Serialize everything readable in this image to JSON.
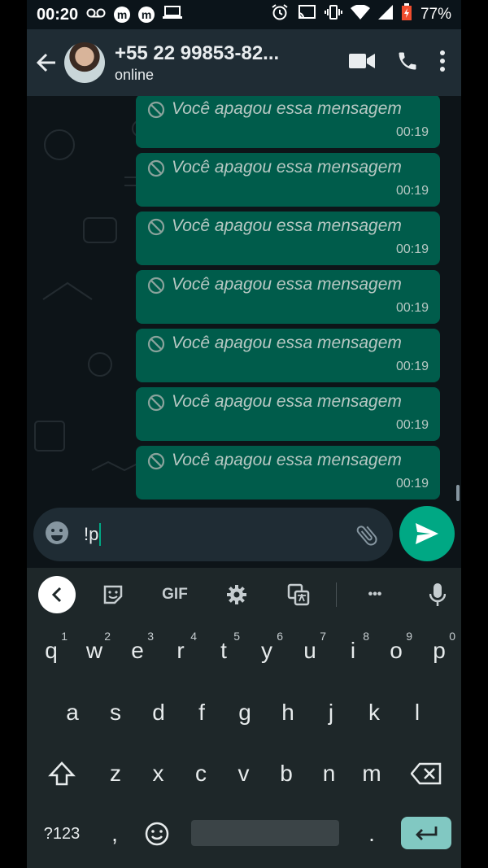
{
  "status_bar": {
    "time": "00:20",
    "battery": "77%",
    "m_glyph": "m"
  },
  "header": {
    "title": "+55 22 99853-82...",
    "subtitle": "online"
  },
  "messages": [
    {
      "text": "Você apagou essa mensagem",
      "time": "00:19"
    },
    {
      "text": "Você apagou essa mensagem",
      "time": "00:19"
    },
    {
      "text": "Você apagou essa mensagem",
      "time": "00:19"
    },
    {
      "text": "Você apagou essa mensagem",
      "time": "00:19"
    },
    {
      "text": "Você apagou essa mensagem",
      "time": "00:19"
    },
    {
      "text": "Você apagou essa mensagem",
      "time": "00:19"
    },
    {
      "text": "Você apagou essa mensagem",
      "time": "00:19"
    }
  ],
  "input": {
    "value": "!p"
  },
  "keyboard": {
    "toolbar": {
      "gif": "GIF",
      "more": "•••"
    },
    "row1": [
      {
        "k": "q",
        "h": "1"
      },
      {
        "k": "w",
        "h": "2"
      },
      {
        "k": "e",
        "h": "3"
      },
      {
        "k": "r",
        "h": "4"
      },
      {
        "k": "t",
        "h": "5"
      },
      {
        "k": "y",
        "h": "6"
      },
      {
        "k": "u",
        "h": "7"
      },
      {
        "k": "i",
        "h": "8"
      },
      {
        "k": "o",
        "h": "9"
      },
      {
        "k": "p",
        "h": "0"
      }
    ],
    "row2": [
      "a",
      "s",
      "d",
      "f",
      "g",
      "h",
      "j",
      "k",
      "l"
    ],
    "row3": [
      "z",
      "x",
      "c",
      "v",
      "b",
      "n",
      "m"
    ],
    "row4": {
      "symbols": "?123",
      "comma": ",",
      "period": "."
    }
  },
  "colors": {
    "accent": "#00a884",
    "bubble": "#005c4b",
    "header": "#1f2c34",
    "keyboard": "#1e2729"
  }
}
